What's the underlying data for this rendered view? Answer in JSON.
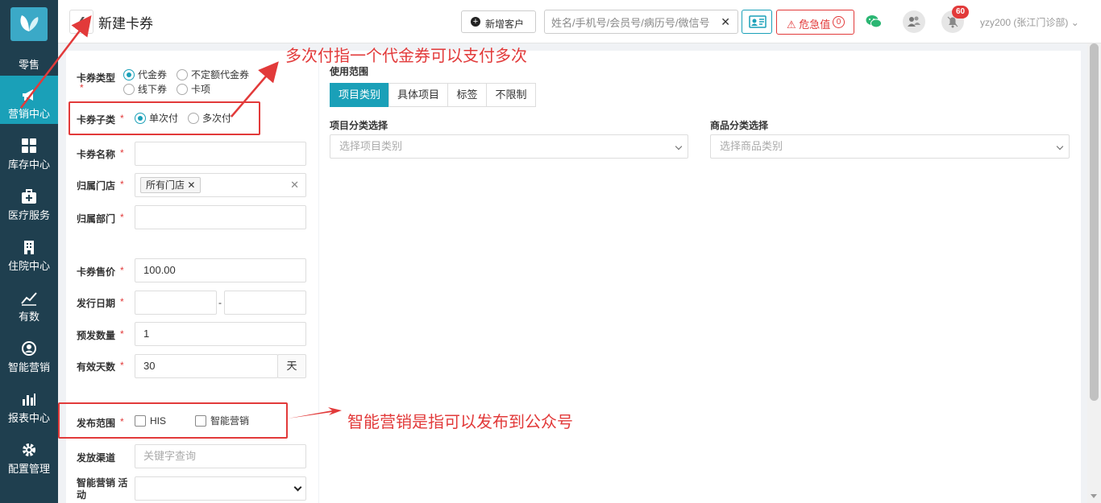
{
  "sidebar": {
    "items": [
      {
        "label": "零售"
      },
      {
        "label": "营销中心"
      },
      {
        "label": "库存中心"
      },
      {
        "label": "医疗服务"
      },
      {
        "label": "住院中心"
      },
      {
        "label": "有数"
      },
      {
        "label": "智能营销"
      },
      {
        "label": "报表中心"
      },
      {
        "label": "配置管理"
      }
    ],
    "active_color": "#1aa0b8",
    "bg_color": "#1f3f4f"
  },
  "header": {
    "title": "新建卡券",
    "new_customer_label": "新增客户",
    "search_placeholder": "姓名/手机号/会员号/病历号/微信号",
    "critical_label": "危急值",
    "critical_count": "0",
    "notification_count": "60",
    "user": "yzy200 (张江门诊部)"
  },
  "form": {
    "card_type": {
      "label": "卡券类型",
      "options": [
        "代金券",
        "不定额代金券",
        "线下券",
        "卡项"
      ],
      "selected": "代金券"
    },
    "card_subtype": {
      "label": "卡券子类",
      "options": [
        "单次付",
        "多次付"
      ],
      "selected": "单次付"
    },
    "card_name": {
      "label": "卡券名称",
      "value": ""
    },
    "store": {
      "label": "归属门店",
      "tag": "所有门店"
    },
    "department": {
      "label": "归属部门",
      "value": ""
    },
    "price": {
      "label": "卡券售价",
      "value": "100.00"
    },
    "issue_date": {
      "label": "发行日期",
      "separator": "-"
    },
    "preissue_qty": {
      "label": "预发数量",
      "value": "1"
    },
    "valid_days": {
      "label": "有效天数",
      "value": "30",
      "unit": "天"
    },
    "publish_scope": {
      "label": "发布范围",
      "options": [
        "HIS",
        "智能营销"
      ]
    },
    "channel": {
      "label": "发放渠道",
      "placeholder": "关键字查询"
    },
    "smart_activity": {
      "label": "智能营销 活动"
    }
  },
  "scope": {
    "title": "使用范围",
    "tabs": [
      "项目类别",
      "具体项目",
      "标签",
      "不限制"
    ],
    "active_tab": "项目类别",
    "project_category": {
      "label": "项目分类选择",
      "placeholder": "选择项目类别"
    },
    "product_category": {
      "label": "商品分类选择",
      "placeholder": "选择商品类别"
    }
  },
  "annotations": {
    "multi_pay_note": "多次付指一个代金券可以支付多次",
    "smart_marketing_note": "智能营销是指可以发布到公众号",
    "color": "#e23a3a"
  }
}
